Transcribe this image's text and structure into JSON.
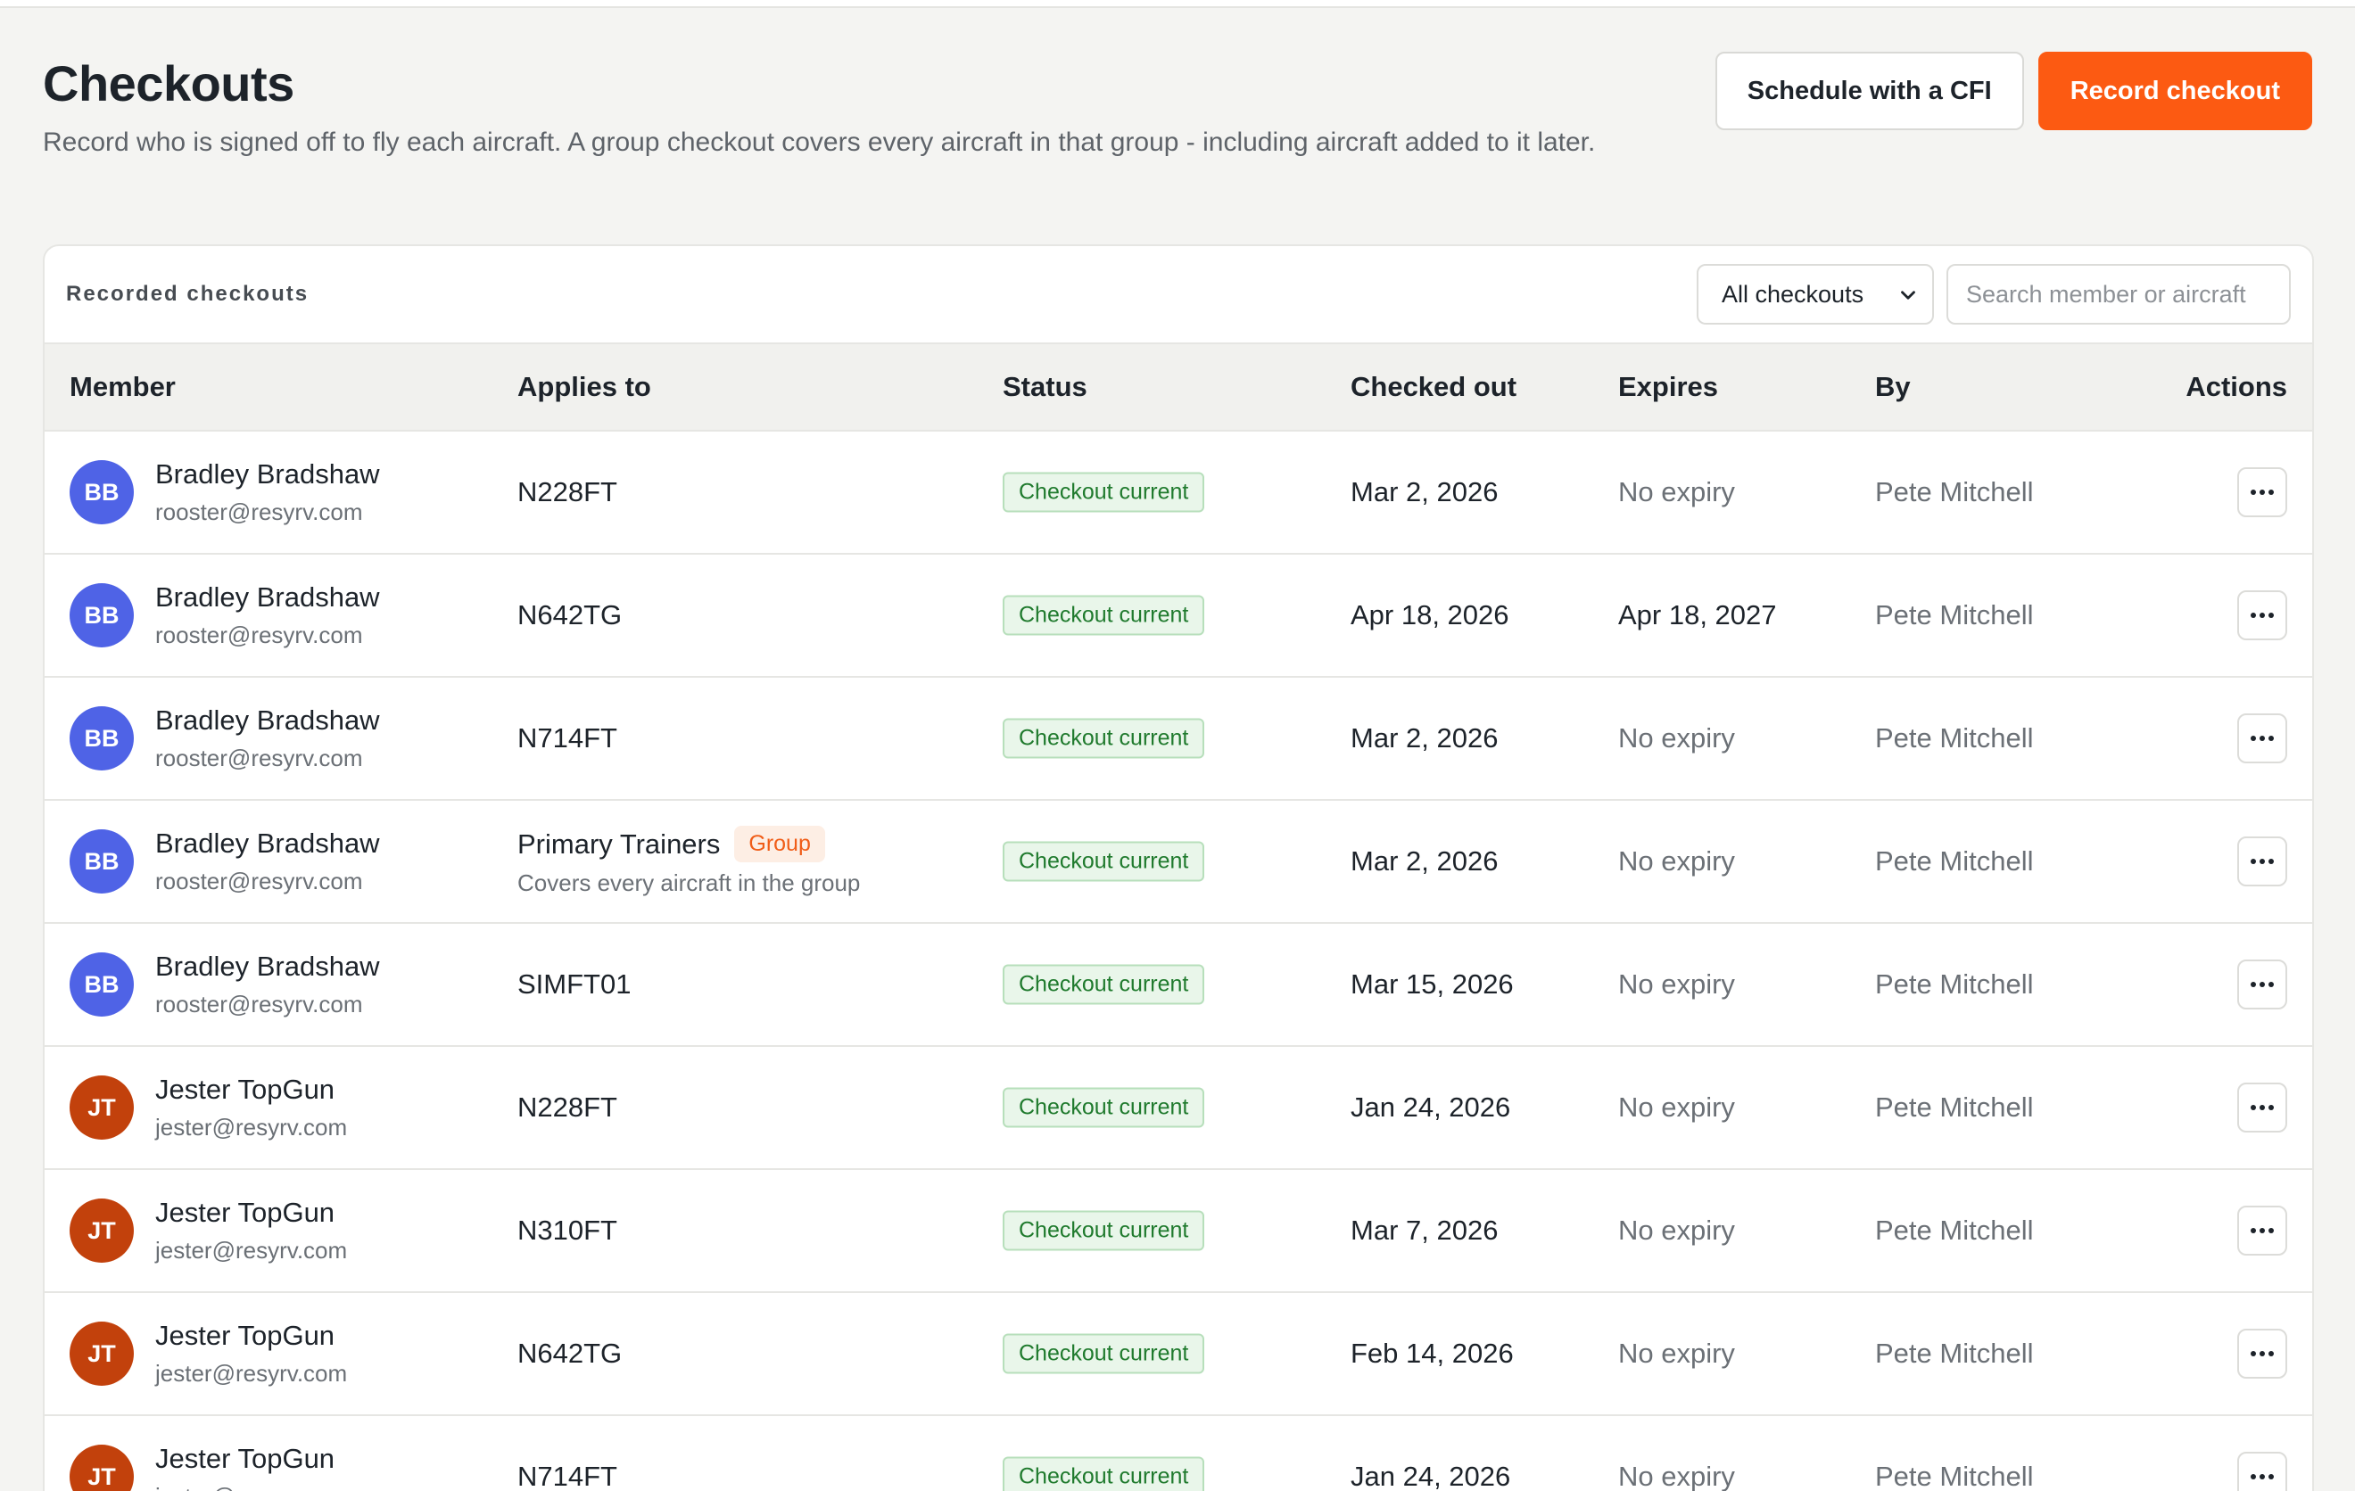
{
  "page": {
    "title": "Checkouts",
    "description": "Record who is signed off to fly each aircraft. A group checkout covers every aircraft in that group - including aircraft added to it later."
  },
  "actions": {
    "schedule_label": "Schedule with a CFI",
    "record_label": "Record checkout"
  },
  "colors": {
    "accent": "#fc5a12",
    "avatar_bb": "#4f63e6",
    "avatar_jt": "#c2410c",
    "status_green": "#1f7a2d"
  },
  "toolbar": {
    "title": "Recorded checkouts",
    "filter_value": "All checkouts",
    "search_placeholder": "Search member or aircraft"
  },
  "table": {
    "headers": {
      "member": "Member",
      "applies": "Applies to",
      "status": "Status",
      "checked": "Checked out",
      "expires": "Expires",
      "by": "By",
      "actions": "Actions"
    },
    "rows": [
      {
        "initials": "BB",
        "avatar_color": "#4f63e6",
        "name": "Bradley Bradshaw",
        "email": "rooster@resyrv.com",
        "applies": "N228FT",
        "tag": "",
        "applies_sub": "",
        "status": "Checkout current",
        "checked": "Mar 2, 2026",
        "expires": "No expiry",
        "by": "Pete Mitchell"
      },
      {
        "initials": "BB",
        "avatar_color": "#4f63e6",
        "name": "Bradley Bradshaw",
        "email": "rooster@resyrv.com",
        "applies": "N642TG",
        "tag": "",
        "applies_sub": "",
        "status": "Checkout current",
        "checked": "Apr 18, 2026",
        "expires": "Apr 18, 2027",
        "by": "Pete Mitchell"
      },
      {
        "initials": "BB",
        "avatar_color": "#4f63e6",
        "name": "Bradley Bradshaw",
        "email": "rooster@resyrv.com",
        "applies": "N714FT",
        "tag": "",
        "applies_sub": "",
        "status": "Checkout current",
        "checked": "Mar 2, 2026",
        "expires": "No expiry",
        "by": "Pete Mitchell"
      },
      {
        "initials": "BB",
        "avatar_color": "#4f63e6",
        "name": "Bradley Bradshaw",
        "email": "rooster@resyrv.com",
        "applies": "Primary Trainers",
        "tag": "Group",
        "applies_sub": "Covers every aircraft in the group",
        "status": "Checkout current",
        "checked": "Mar 2, 2026",
        "expires": "No expiry",
        "by": "Pete Mitchell"
      },
      {
        "initials": "BB",
        "avatar_color": "#4f63e6",
        "name": "Bradley Bradshaw",
        "email": "rooster@resyrv.com",
        "applies": "SIMFT01",
        "tag": "",
        "applies_sub": "",
        "status": "Checkout current",
        "checked": "Mar 15, 2026",
        "expires": "No expiry",
        "by": "Pete Mitchell"
      },
      {
        "initials": "JT",
        "avatar_color": "#c2410c",
        "name": "Jester TopGun",
        "email": "jester@resyrv.com",
        "applies": "N228FT",
        "tag": "",
        "applies_sub": "",
        "status": "Checkout current",
        "checked": "Jan 24, 2026",
        "expires": "No expiry",
        "by": "Pete Mitchell"
      },
      {
        "initials": "JT",
        "avatar_color": "#c2410c",
        "name": "Jester TopGun",
        "email": "jester@resyrv.com",
        "applies": "N310FT",
        "tag": "",
        "applies_sub": "",
        "status": "Checkout current",
        "checked": "Mar 7, 2026",
        "expires": "No expiry",
        "by": "Pete Mitchell"
      },
      {
        "initials": "JT",
        "avatar_color": "#c2410c",
        "name": "Jester TopGun",
        "email": "jester@resyrv.com",
        "applies": "N642TG",
        "tag": "",
        "applies_sub": "",
        "status": "Checkout current",
        "checked": "Feb 14, 2026",
        "expires": "No expiry",
        "by": "Pete Mitchell"
      },
      {
        "initials": "JT",
        "avatar_color": "#c2410c",
        "name": "Jester TopGun",
        "email": "jester@resyrv.com",
        "applies": "N714FT",
        "tag": "",
        "applies_sub": "",
        "status": "Checkout current",
        "checked": "Jan 24, 2026",
        "expires": "No expiry",
        "by": "Pete Mitchell"
      }
    ]
  }
}
